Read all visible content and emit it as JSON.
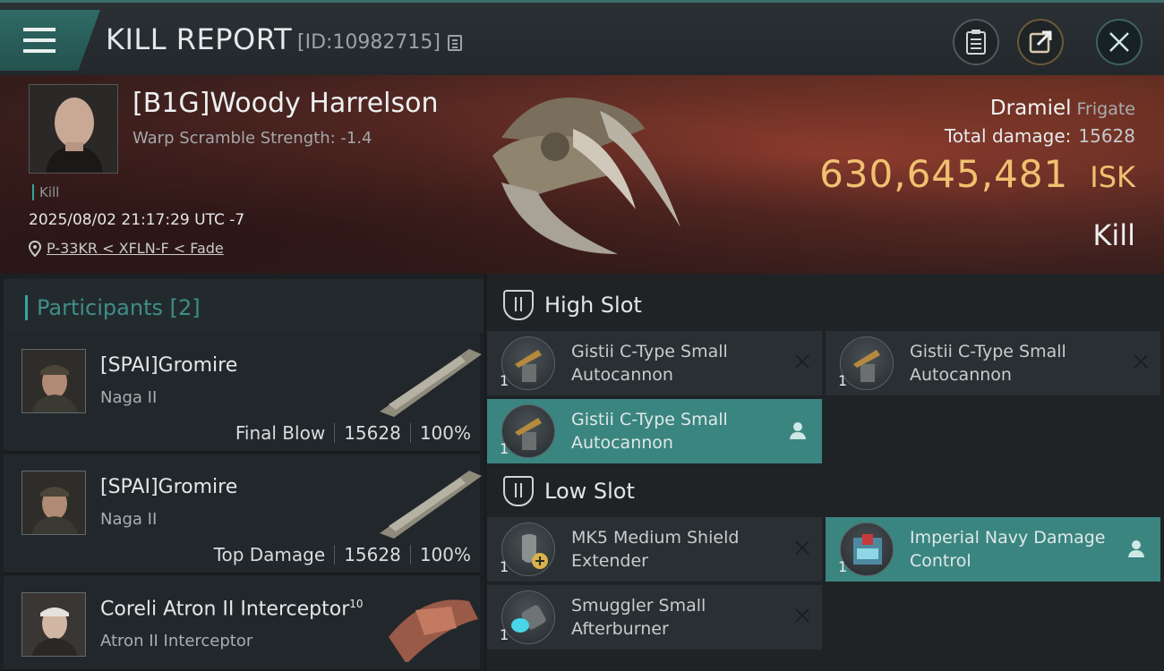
{
  "header": {
    "title": "KILL REPORT",
    "report_id": "[ID:10982715]",
    "menu_icon": "hamburger-menu-icon",
    "buttons": [
      "clipboard-icon",
      "share-icon",
      "close-icon"
    ]
  },
  "victim": {
    "name": "[B1G]Woody Harrelson",
    "scramble": "Warp Scramble Strength: -1.4",
    "tag": "Kill",
    "timestamp": "2025/08/02 21:17:29 UTC -7",
    "location": "P-33KR < XFLN-F < Fade",
    "ship": "Dramiel",
    "ship_class": "Frigate",
    "total_damage_label": "Total damage:",
    "total_damage": "15628",
    "isk_value": "630,645,481",
    "isk_unit": "ISK",
    "kill_type": "Kill"
  },
  "participants": {
    "header": "Participants [2]",
    "items": [
      {
        "name": "[SPAI]Gromire",
        "ship": "Naga II",
        "role": "Final Blow",
        "damage": "15628",
        "percent": "100%"
      },
      {
        "name": "[SPAI]Gromire",
        "ship": "Naga II",
        "role": "Top Damage",
        "damage": "15628",
        "percent": "100%"
      },
      {
        "name": "Coreli Atron II Interceptor",
        "sup": "10",
        "ship": "Atron II Interceptor"
      }
    ]
  },
  "slots": {
    "high": {
      "label": "High Slot",
      "modules": [
        {
          "name": "Gistii C-Type Small Autocannon",
          "qty": "1",
          "status": "destroyed"
        },
        {
          "name": "Gistii C-Type Small Autocannon",
          "qty": "1",
          "status": "destroyed"
        },
        {
          "name": "Gistii C-Type Small Autocannon",
          "qty": "1",
          "status": "dropped"
        }
      ]
    },
    "low": {
      "label": "Low Slot",
      "modules": [
        {
          "name": "MK5 Medium Shield Extender",
          "qty": "1",
          "status": "destroyed"
        },
        {
          "name": "Imperial Navy Damage Control",
          "qty": "1",
          "status": "dropped"
        },
        {
          "name": "Smuggler Small Afterburner",
          "qty": "1",
          "status": "destroyed"
        }
      ]
    }
  },
  "colors": {
    "accent": "#3a8580",
    "isk": "#f0c070",
    "hero_bg": "#5c2a24"
  }
}
